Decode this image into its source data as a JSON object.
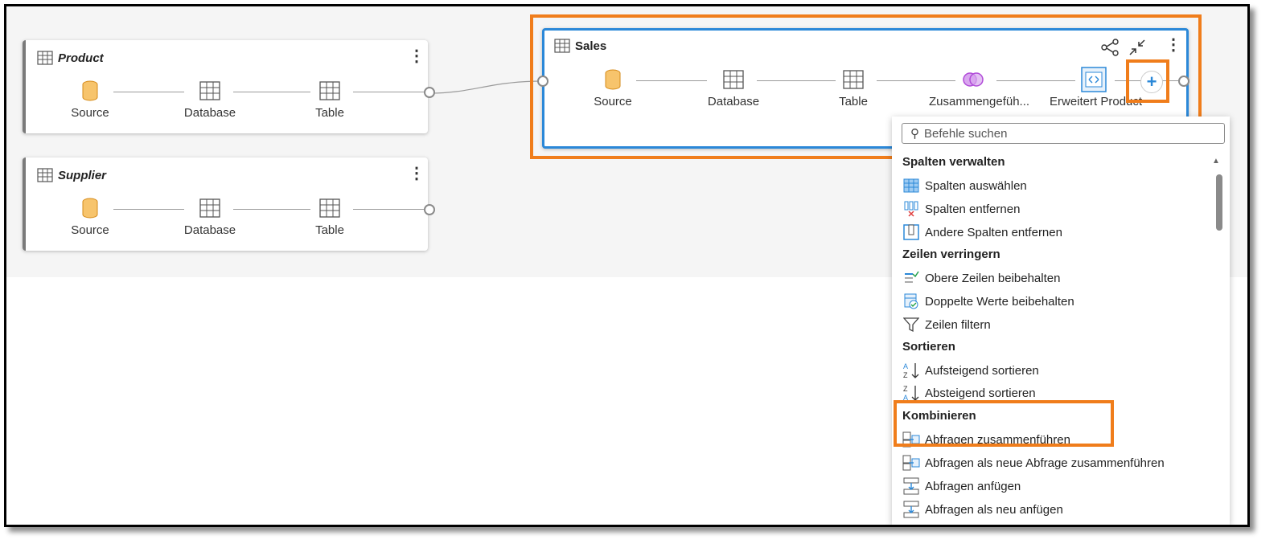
{
  "queries": {
    "product": {
      "title": "Product",
      "steps": [
        "Source",
        "Database",
        "Table"
      ]
    },
    "supplier": {
      "title": "Supplier",
      "steps": [
        "Source",
        "Database",
        "Table"
      ]
    },
    "sales": {
      "title": "Sales",
      "steps": [
        "Source",
        "Database",
        "Table",
        "Zusammengefüh...",
        "Erweitert Product"
      ]
    }
  },
  "menu": {
    "search_placeholder": "Befehle suchen",
    "groups": [
      {
        "label": "Spalten verwalten",
        "items": [
          {
            "label": "Spalten auswählen",
            "icon": "choose-columns-icon"
          },
          {
            "label": "Spalten entfernen",
            "icon": "remove-columns-icon"
          },
          {
            "label": "Andere Spalten entfernen",
            "icon": "remove-other-columns-icon"
          }
        ]
      },
      {
        "label": "Zeilen verringern",
        "items": [
          {
            "label": "Obere Zeilen beibehalten",
            "icon": "keep-top-rows-icon"
          },
          {
            "label": "Doppelte Werte beibehalten",
            "icon": "keep-duplicates-icon"
          },
          {
            "label": "Zeilen filtern",
            "icon": "filter-icon"
          }
        ]
      },
      {
        "label": "Sortieren",
        "items": [
          {
            "label": "Aufsteigend sortieren",
            "icon": "sort-ascending-icon"
          },
          {
            "label": "Absteigend sortieren",
            "icon": "sort-descending-icon"
          }
        ]
      },
      {
        "label": "Kombinieren",
        "items": [
          {
            "label": "Abfragen zusammenführen",
            "icon": "merge-queries-icon"
          },
          {
            "label": "Abfragen als neue Abfrage zusammenführen",
            "icon": "merge-queries-new-icon"
          },
          {
            "label": "Abfragen anfügen",
            "icon": "append-queries-icon"
          },
          {
            "label": "Abfragen als neu anfügen",
            "icon": "append-queries-new-icon"
          }
        ]
      }
    ]
  },
  "colors": {
    "highlight": "#f07d1b",
    "selection": "#2b88d8",
    "source_icon": "#f0a030",
    "merge_icon": "#b04ad8"
  }
}
